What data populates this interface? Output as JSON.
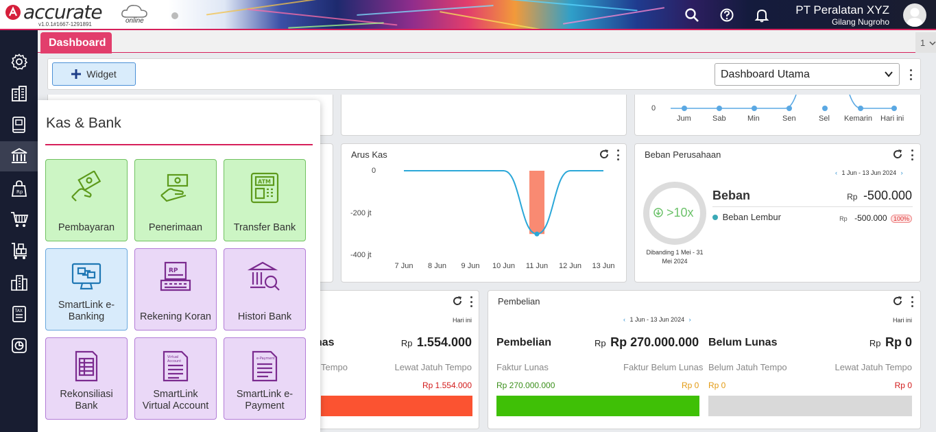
{
  "app": {
    "logo_text": "accurate",
    "logo_sub": "online",
    "version": "v1.0.1#1667-1291891"
  },
  "header": {
    "company": "PT Peralatan XYZ",
    "user": "Gilang Nugroho",
    "icons": [
      "search-icon",
      "help-icon",
      "bell-icon",
      "avatar"
    ]
  },
  "sidebar": {
    "items": [
      "gear-icon",
      "building-icon",
      "book-icon",
      "bank-icon",
      "sales-bag-icon",
      "cart-icon",
      "inventory-icon",
      "city-icon",
      "tax-icon",
      "report-icon"
    ],
    "active_index": 3
  },
  "tabs": {
    "active": "Dashboard",
    "count": "1"
  },
  "toolbar": {
    "widget_label": "Widget",
    "dashboard_select": "Dashboard Utama"
  },
  "top_chart": {
    "ytick": "0",
    "categories": [
      "Jum",
      "Sab",
      "Min",
      "Sen",
      "Sel",
      "Kemarin",
      "Hari ini"
    ]
  },
  "arus_kas": {
    "title": "Arus Kas",
    "chart_data": {
      "type": "line",
      "title": "Arus Kas",
      "categories": [
        "7 Jun",
        "8 Jun",
        "9 Jun",
        "10 Jun",
        "11 Jun",
        "12 Jun",
        "13 Jun"
      ],
      "yticks": [
        "0",
        "-200 jt",
        "-400 jt"
      ],
      "ylim": [
        -400,
        0
      ],
      "bar_values": [
        0,
        0,
        0,
        0,
        -300,
        0,
        0
      ],
      "line_values": [
        0,
        0,
        0,
        0,
        -300,
        0,
        0
      ],
      "colors": {
        "bar": "#f98a72",
        "line": "#2aa7d8"
      }
    }
  },
  "beban": {
    "title": "Beban Perusahaan",
    "date_range": "1 Jun - 13 Jun 2024",
    "ratio": ">10x",
    "compare": "Dibanding 1 Mei - 31 Mei 2024",
    "label": "Beban",
    "currency": "Rp",
    "total": "-500.000",
    "items": [
      {
        "name": "Beban Lembur",
        "currency": "Rp",
        "value": "-500.000",
        "pct": "100%"
      }
    ]
  },
  "penjualan": {
    "today": "Hari ini",
    "label_fragment": "nas",
    "currency": "Rp",
    "value": "1.554.000",
    "col_left": "Tempo",
    "col_right": "Lewat Jatuh Tempo",
    "right_value": "Rp 1.554.000",
    "bar_color": "#fb5331"
  },
  "pembelian": {
    "title": "Pembelian",
    "date_range": "1 Jun - 13 Jun 2024",
    "today": "Hari ini",
    "left_label": "Pembelian",
    "left_currency": "Rp",
    "left_value": "Rp 270.000.000",
    "right_label": "Belum Lunas",
    "right_currency": "Rp",
    "right_value": "Rp 0",
    "lunas": "Faktur Lunas",
    "belum_lunas": "Faktur Belum Lunas",
    "belum_jatuh": "Belum Jatuh Tempo",
    "lewat_jatuh": "Lewat Jatuh Tempo",
    "lunas_value": "Rp 270.000.000",
    "belum_lunas_value": "Rp 0",
    "belum_jatuh_value": "Rp 0",
    "lewat_jatuh_value": "Rp 0",
    "colors": {
      "paid": "#3fc006",
      "unpaid": "#d9d9d9"
    }
  },
  "popup": {
    "title": "Kas & Bank",
    "tiles": [
      {
        "label": "Pembayaran",
        "style": "green",
        "icon": "payment-hand-icon"
      },
      {
        "label": "Penerimaan",
        "style": "green",
        "icon": "receive-money-icon"
      },
      {
        "label": "Transfer Bank",
        "style": "green",
        "icon": "atm-icon"
      },
      {
        "label": "SmartLink e-Banking",
        "style": "blue",
        "icon": "ebanking-monitor-icon"
      },
      {
        "label": "Rekening Koran",
        "style": "purple",
        "icon": "bank-statement-icon"
      },
      {
        "label": "Histori Bank",
        "style": "purple",
        "icon": "bank-search-icon"
      },
      {
        "label": "Rekonsiliasi Bank",
        "style": "purple",
        "icon": "reconcile-doc-icon"
      },
      {
        "label": "SmartLink Virtual Account",
        "style": "purple",
        "icon": "virtual-account-doc-icon"
      },
      {
        "label": "SmartLink e-Payment",
        "style": "purple",
        "icon": "epayment-doc-icon"
      }
    ]
  }
}
